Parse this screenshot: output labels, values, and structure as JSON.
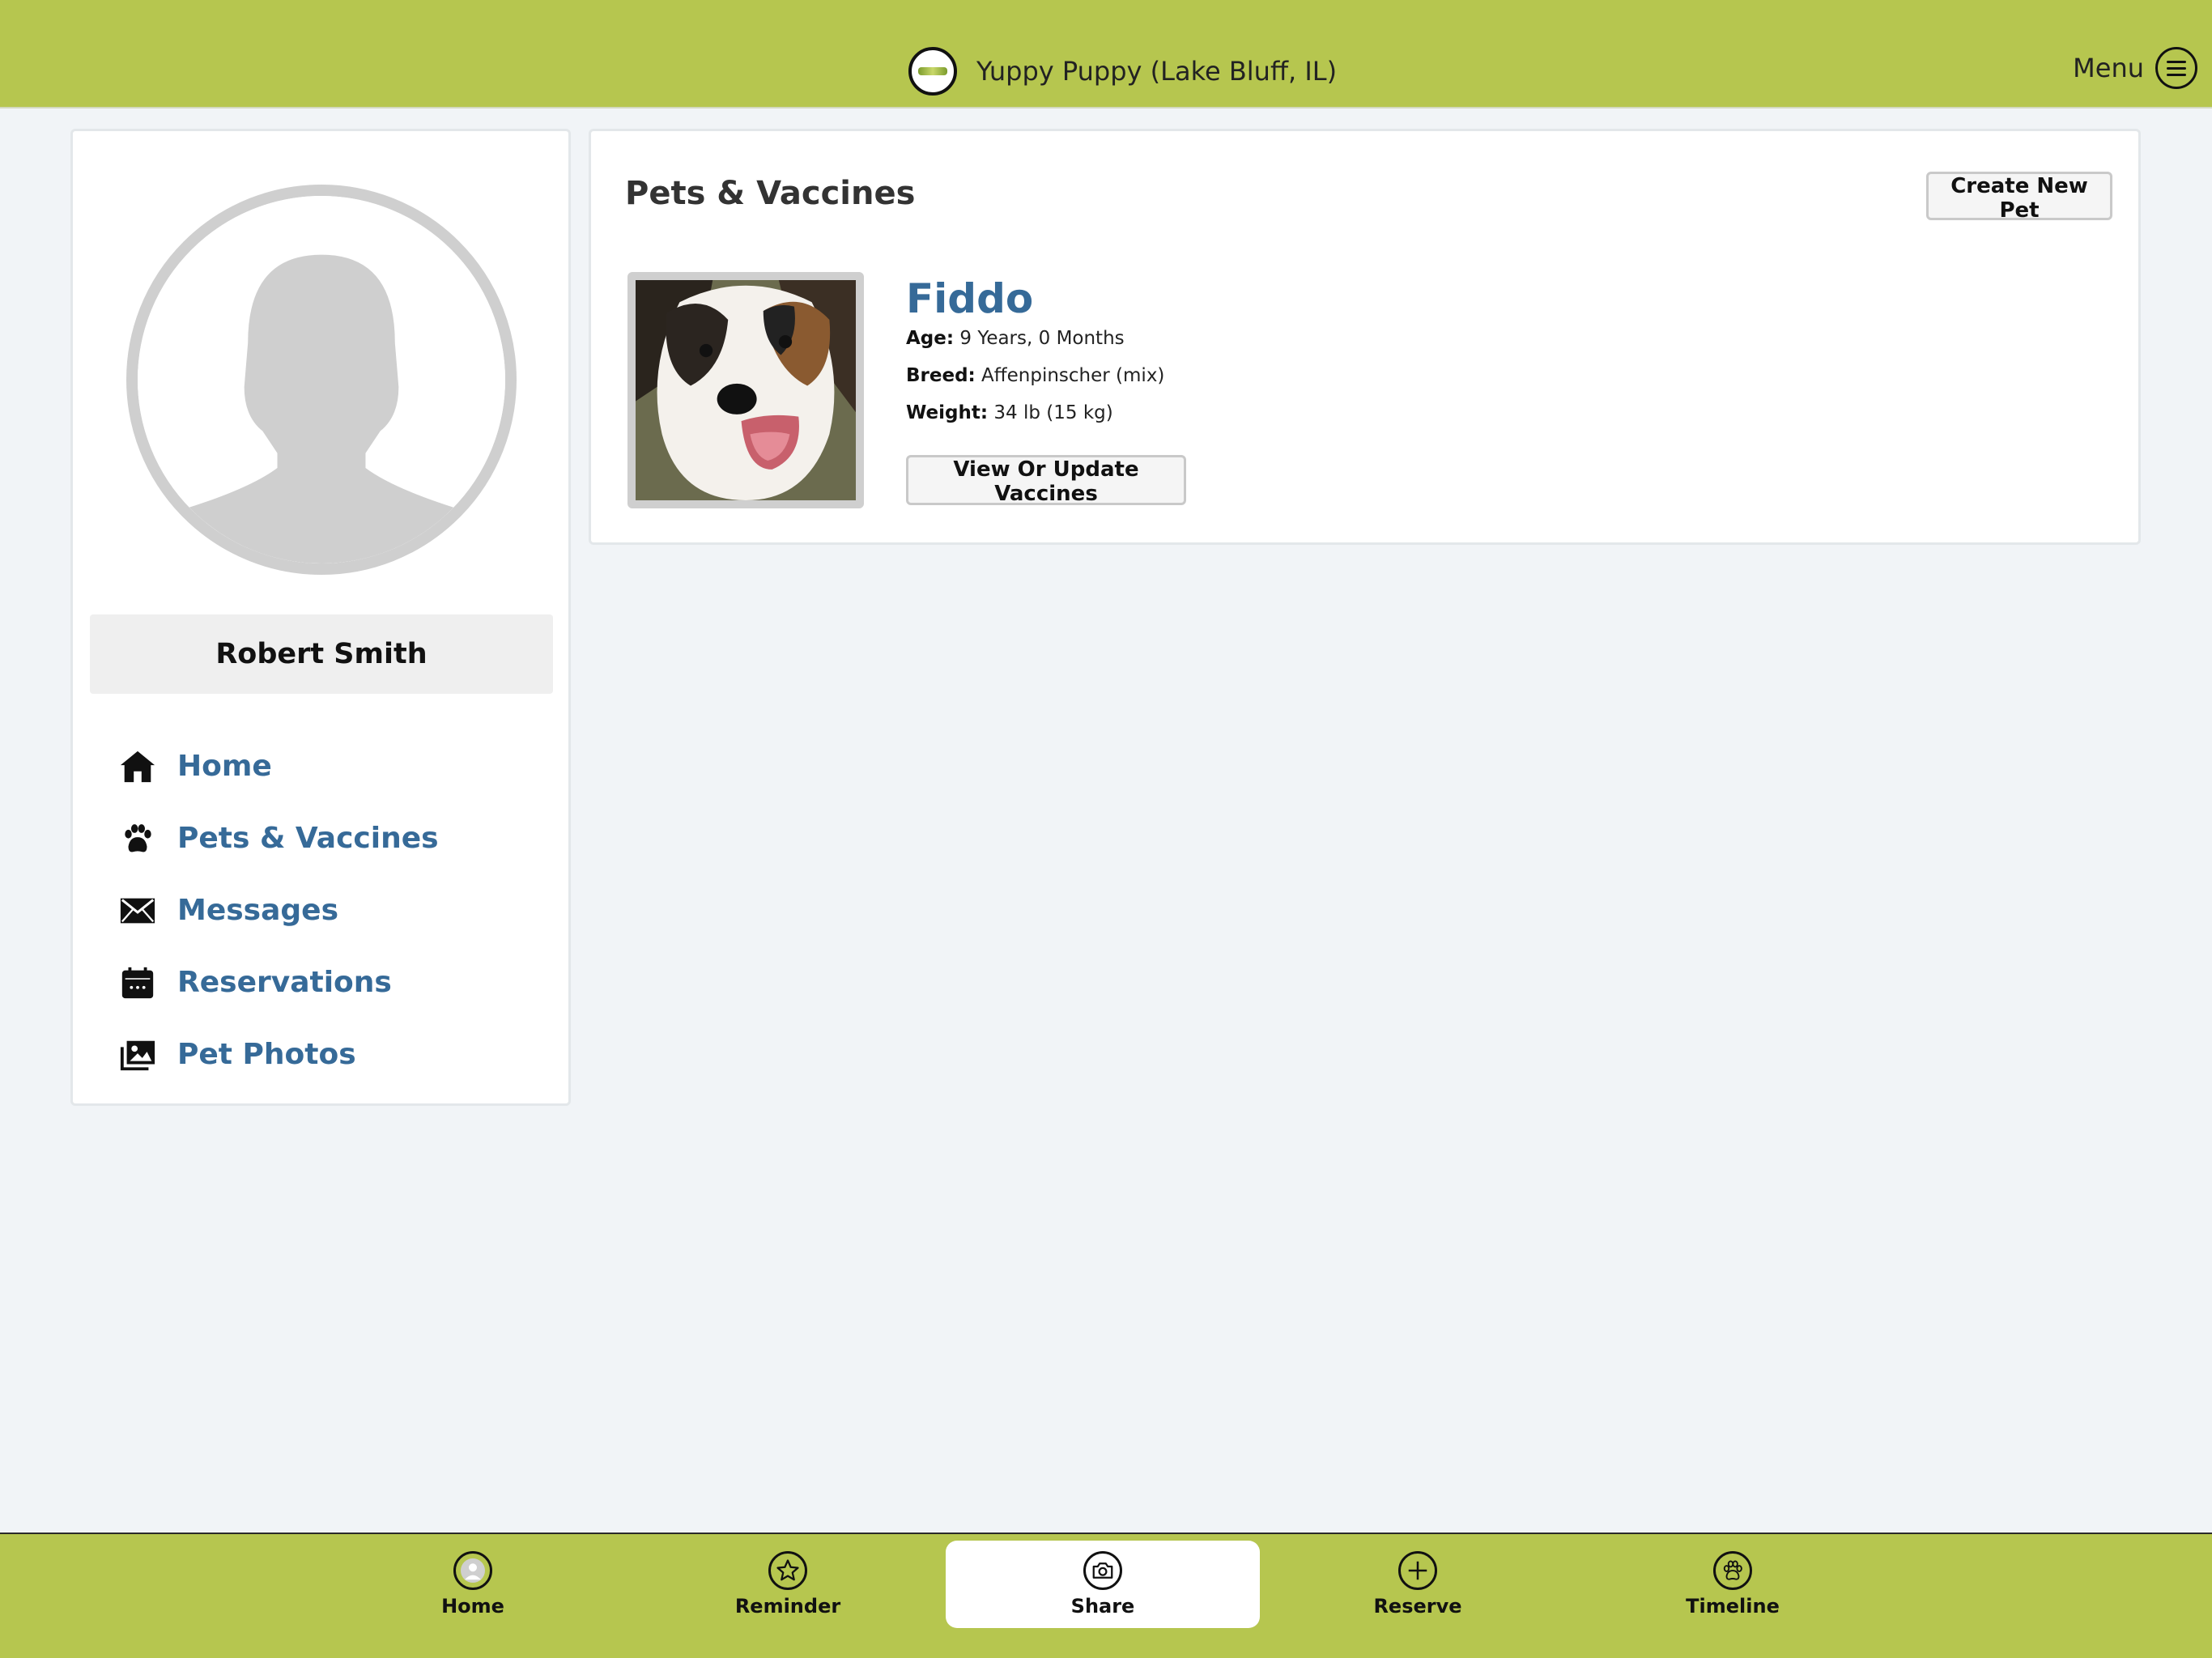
{
  "header": {
    "title": "Yuppy Puppy (Lake Bluff, IL)",
    "menu_label": "Menu",
    "logo_icon": "brand-logo-icon",
    "menu_icon": "hamburger-icon",
    "bg_color": "#b6c64f"
  },
  "sidebar": {
    "user_name": "Robert Smith",
    "avatar_icon": "user-silhouette-icon",
    "items": [
      {
        "label": "Home",
        "icon": "home-icon"
      },
      {
        "label": "Pets & Vaccines",
        "icon": "paw-icon"
      },
      {
        "label": "Messages",
        "icon": "envelope-icon"
      },
      {
        "label": "Reservations",
        "icon": "calendar-icon"
      },
      {
        "label": "Pet Photos",
        "icon": "photos-icon"
      }
    ],
    "link_color": "#366a98"
  },
  "main": {
    "section_title": "Pets & Vaccines",
    "create_button": "Create New Pet",
    "pet": {
      "name": "Fiddo",
      "age_label": "Age:",
      "age_value": "9 Years, 0 Months",
      "breed_label": "Breed:",
      "breed_value": "Affenpinscher (mix)",
      "weight_label": "Weight:",
      "weight_value": "34 lb (15 kg)",
      "vaccines_button": "View Or Update Vaccines"
    }
  },
  "tabbar": {
    "tabs": [
      {
        "label": "Home",
        "icon": "user-circle-icon"
      },
      {
        "label": "Reminder",
        "icon": "star-icon"
      },
      {
        "label": "Share",
        "icon": "camera-icon",
        "active": true
      },
      {
        "label": "Reserve",
        "icon": "plus-icon"
      },
      {
        "label": "Timeline",
        "icon": "paw-icon"
      }
    ]
  }
}
